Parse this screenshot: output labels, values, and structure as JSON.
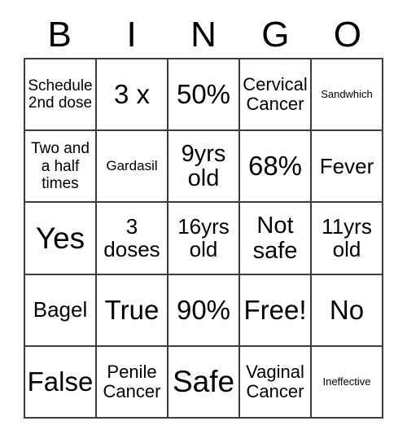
{
  "card": {
    "title_letters": [
      "B",
      "I",
      "N",
      "G",
      "O"
    ],
    "border_color": "#3d3d3d",
    "background_color": "#ffffff",
    "text_color": "#000000",
    "columns": 5,
    "rows": 5
  },
  "grid": {
    "cells": [
      [
        {
          "text": "Schedule\n2nd dose",
          "size": "fs-s"
        },
        {
          "text": "3 x",
          "size": "fs-xl"
        },
        {
          "text": "50%",
          "size": "fs-xl"
        },
        {
          "text": "Cervical\nCancer",
          "size": "fs-m"
        },
        {
          "text": "Sandwhich",
          "size": "fs-xxs"
        }
      ],
      [
        {
          "text": "Two and\na half\ntimes",
          "size": "fs-s"
        },
        {
          "text": "Gardasil",
          "size": "fs-xs"
        },
        {
          "text": "9yrs\nold",
          "size": "fs-l"
        },
        {
          "text": "68%",
          "size": "fs-xl"
        },
        {
          "text": "Fever",
          "size": "fs-ml"
        }
      ],
      [
        {
          "text": "Yes",
          "size": "fs-xxl"
        },
        {
          "text": "3\ndoses",
          "size": "fs-ml"
        },
        {
          "text": "16yrs\nold",
          "size": "fs-ml"
        },
        {
          "text": "Not\nsafe",
          "size": "fs-l"
        },
        {
          "text": "11yrs\nold",
          "size": "fs-ml"
        }
      ],
      [
        {
          "text": "Bagel",
          "size": "fs-ml"
        },
        {
          "text": "True",
          "size": "fs-xl"
        },
        {
          "text": "90%",
          "size": "fs-xl"
        },
        {
          "text": "Free!",
          "size": "fs-xl"
        },
        {
          "text": "No",
          "size": "fs-xl"
        }
      ],
      [
        {
          "text": "False",
          "size": "fs-xl"
        },
        {
          "text": "Penile\nCancer",
          "size": "fs-m"
        },
        {
          "text": "Safe",
          "size": "fs-xxl"
        },
        {
          "text": "Vaginal\nCancer",
          "size": "fs-m"
        },
        {
          "text": "Ineffective",
          "size": "fs-xxs"
        }
      ]
    ]
  }
}
